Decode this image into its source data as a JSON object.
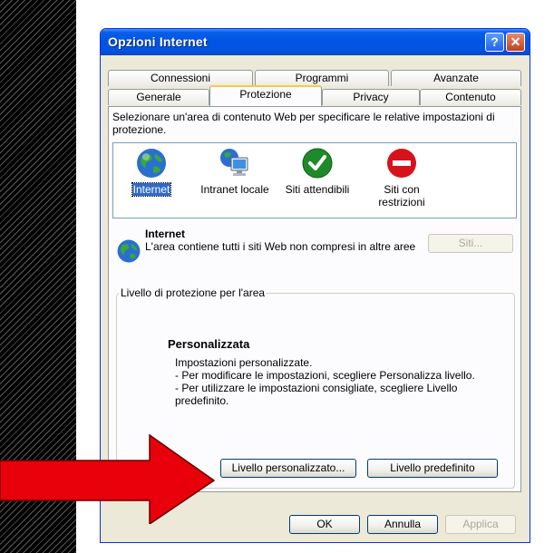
{
  "window": {
    "title": "Opzioni Internet",
    "help_label": "?",
    "close_label": "✕"
  },
  "tabs_back": [
    "Connessioni",
    "Programmi",
    "Avanzate"
  ],
  "tabs_front": [
    "Generale",
    "Protezione",
    "Privacy",
    "Contenuto"
  ],
  "active_tab": "Protezione",
  "instructions": "Selezionare un'area di contenuto Web per specificare le relative impostazioni di protezione.",
  "zones": [
    {
      "label": "Internet",
      "icon": "globe-icon",
      "selected": true
    },
    {
      "label": "Intranet locale",
      "icon": "network-computer-icon",
      "selected": false
    },
    {
      "label": "Siti attendibili",
      "icon": "checkmark-icon",
      "selected": false
    },
    {
      "label": "Siti con restrizioni",
      "icon": "no-entry-icon",
      "selected": false
    }
  ],
  "zone_info": {
    "title": "Internet",
    "description": "L'area contiene tutti i siti Web non compresi in altre aree",
    "sites_button": "Siti..."
  },
  "security_level": {
    "group_label": "Livello di protezione per l'area",
    "title": "Personalizzata",
    "lines": [
      "Impostazioni personalizzate.",
      "- Per modificare le impostazioni, scegliere Personalizza livello.",
      "- Per utilizzare le impostazioni consigliate, scegliere Livello predefinito."
    ],
    "custom_button": "Livello personalizzato...",
    "default_button": "Livello predefinito"
  },
  "footer": {
    "ok": "OK",
    "cancel": "Annulla",
    "apply": "Applica"
  },
  "colors": {
    "titlebar": "#0054e3",
    "selection": "#316ac5",
    "arrow": "#e8000a"
  }
}
